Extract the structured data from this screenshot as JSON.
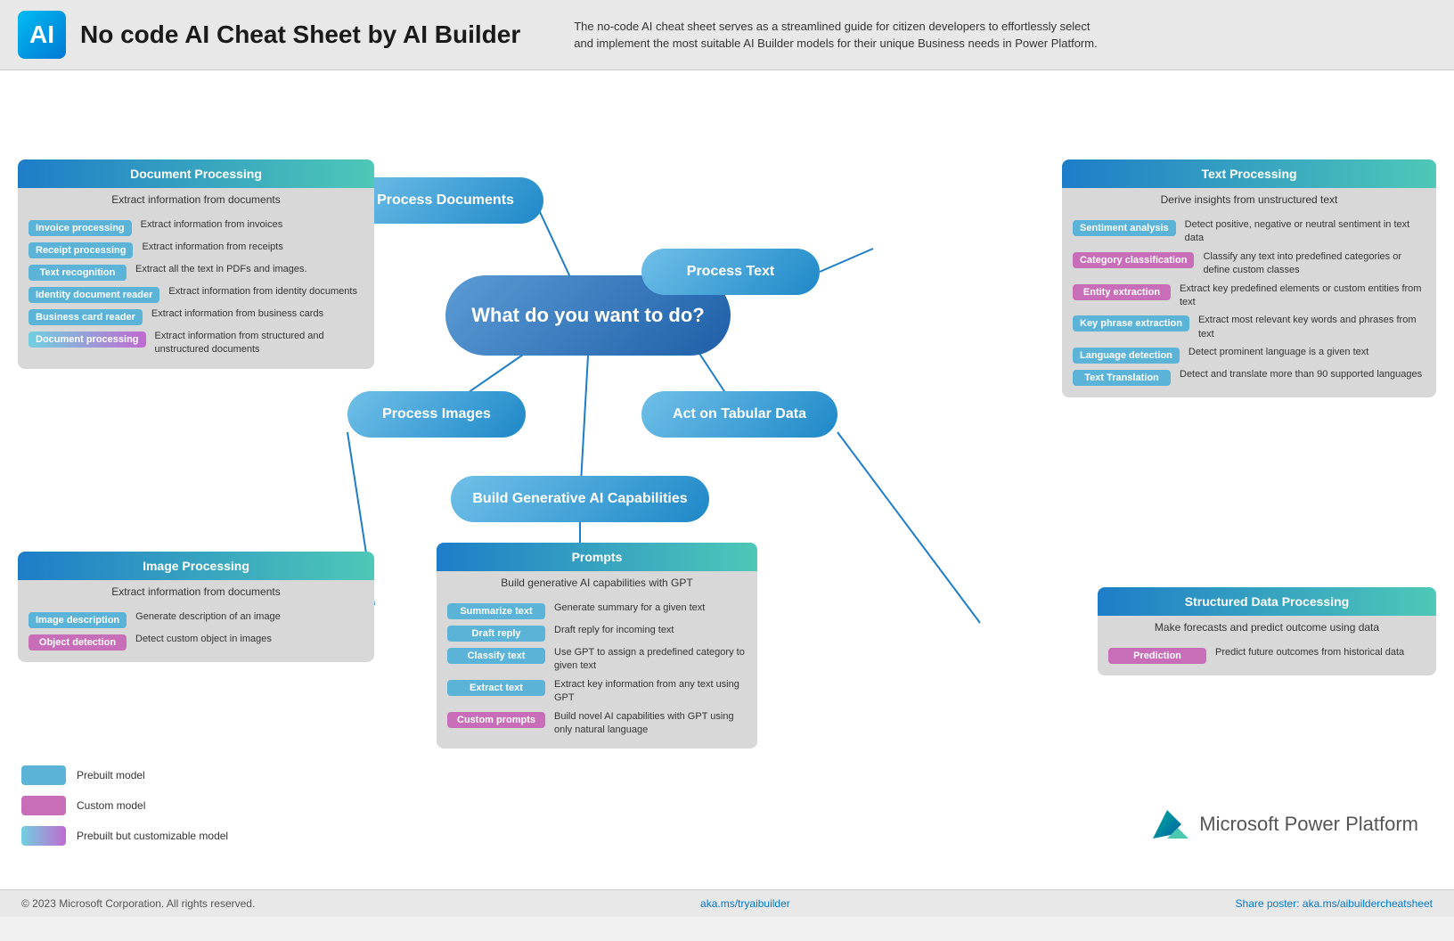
{
  "header": {
    "title": "No code AI Cheat Sheet by AI Builder",
    "description": "The no-code AI cheat sheet serves as a streamlined guide for citizen developers to effortlessly select and implement the most suitable AI Builder models for their unique Business needs in Power Platform."
  },
  "main_question": "What do you want to do?",
  "nodes": {
    "process_documents": "Process Documents",
    "process_text": "Process Text",
    "process_images": "Process Images",
    "act_on_tabular": "Act on Tabular Data",
    "build_generative": "Build Generative AI Capabilities"
  },
  "doc_processing": {
    "title": "Document Processing",
    "subtitle": "Extract information from documents",
    "items": [
      {
        "tag": "Invoice processing",
        "desc": "Extract information from invoices",
        "type": "blue"
      },
      {
        "tag": "Receipt processing",
        "desc": "Extract information from receipts",
        "type": "blue"
      },
      {
        "tag": "Text  recognition",
        "desc": "Extract all the text in PDFs and images.",
        "type": "blue"
      },
      {
        "tag": "Identity document reader",
        "desc": "Extract information from identity documents",
        "type": "blue"
      },
      {
        "tag": "Business card reader",
        "desc": "Extract information from business cards",
        "type": "blue"
      },
      {
        "tag": "Document processing",
        "desc": "Extract information from structured and unstructured documents",
        "type": "gradient"
      }
    ]
  },
  "img_processing": {
    "title": "Image Processing",
    "subtitle": "Extract information from documents",
    "items": [
      {
        "tag": "Image description",
        "desc": "Generate description of an image",
        "type": "blue"
      },
      {
        "tag": "Object detection",
        "desc": "Detect custom object in images",
        "type": "pink"
      }
    ]
  },
  "text_processing": {
    "title": "Text Processing",
    "subtitle": "Derive insights from unstructured text",
    "items": [
      {
        "tag": "Sentiment analysis",
        "desc": "Detect positive, negative or neutral sentiment in text data",
        "type": "blue"
      },
      {
        "tag": "Category classification",
        "desc": "Classify any text into predefined categories or define custom classes",
        "type": "pink"
      },
      {
        "tag": "Entity extraction",
        "desc": "Extract key predefined elements or custom entities from text",
        "type": "pink"
      },
      {
        "tag": "Key phrase extraction",
        "desc": "Extract most relevant key words and phrases from text",
        "type": "blue"
      },
      {
        "tag": "Language detection",
        "desc": "Detect prominent language is a given text",
        "type": "blue"
      },
      {
        "tag": "Text Translation",
        "desc": "Detect and translate more than 90 supported languages",
        "type": "blue"
      }
    ]
  },
  "structured_data": {
    "title": "Structured Data Processing",
    "subtitle": "Make forecasts and predict outcome using data",
    "items": [
      {
        "tag": "Prediction",
        "desc": "Predict future outcomes from historical data",
        "type": "pink"
      }
    ]
  },
  "prompts": {
    "title": "Prompts",
    "subtitle": "Build generative AI capabilities with GPT",
    "items": [
      {
        "tag": "Summarize text",
        "desc": "Generate summary for a given text",
        "type": "blue"
      },
      {
        "tag": "Draft reply",
        "desc": "Draft reply for incoming text",
        "type": "blue"
      },
      {
        "tag": "Classify text",
        "desc": "Use GPT to assign a predefined category to given text",
        "type": "blue"
      },
      {
        "tag": "Extract text",
        "desc": "Extract key information from any text using GPT",
        "type": "blue"
      },
      {
        "tag": "Custom prompts",
        "desc": "Build novel AI capabilities with GPT using only natural language",
        "type": "pink"
      }
    ]
  },
  "legend": [
    {
      "label": "Prebuilt model",
      "type": "blue"
    },
    {
      "label": "Custom model",
      "type": "pink"
    },
    {
      "label": "Prebuilt but customizable model",
      "type": "gradient"
    }
  ],
  "footer": {
    "copyright": "© 2023 Microsoft Corporation. All rights reserved.",
    "center": "aka.ms/tryaibuilder",
    "right": "Share poster: aka.ms/aibuildercheatsheet"
  },
  "power_platform": "Microsoft Power Platform"
}
